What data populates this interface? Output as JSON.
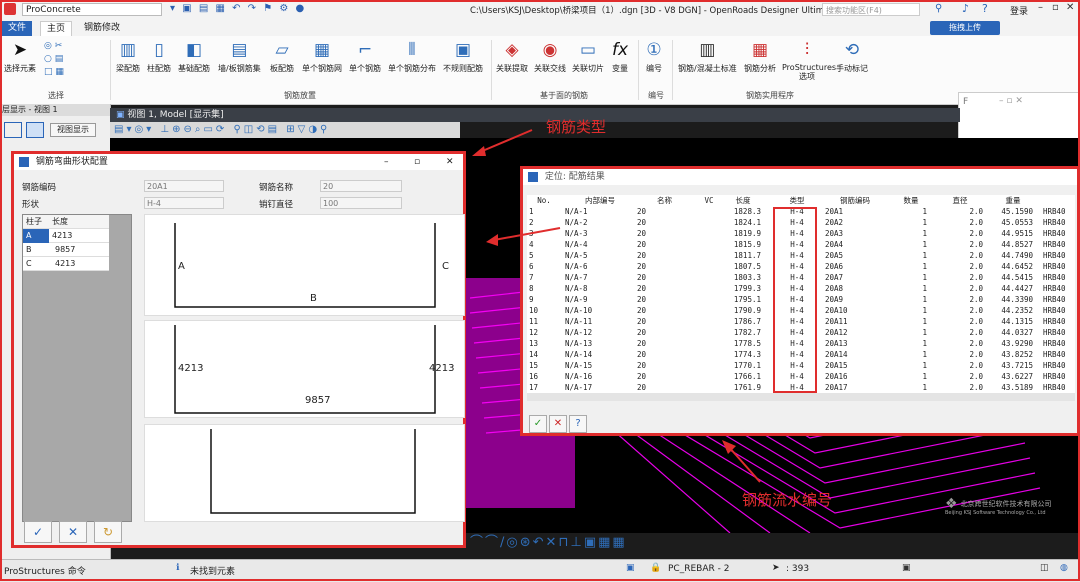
{
  "titlebar": {
    "workflow": "ProConcrete",
    "document": "C:\\Users\\KSJ\\Desktop\\桥梁项目（1）.dgn [3D - V8 DGN] - OpenRoads Designer Ultimate For Ch",
    "search_placeholder": "搜索功能区(F4)",
    "login": "登录",
    "share": "拖拽上传"
  },
  "tabs": [
    {
      "label": "文件"
    },
    {
      "label": "主页"
    },
    {
      "label": "钢筋修改"
    }
  ],
  "ribbon": {
    "select_label": "选择元素",
    "select_group": "选择",
    "buttons": [
      {
        "label": "梁配筋"
      },
      {
        "label": "柱配筋"
      },
      {
        "label": "基础配筋"
      },
      {
        "label": "墙/板钢筋集"
      },
      {
        "label": "板配筋"
      },
      {
        "label": "单个钢筋网"
      },
      {
        "label": "单个钢筋"
      },
      {
        "label": "单个钢筋分布"
      },
      {
        "label": "不规则配筋"
      },
      {
        "label": "关联提取"
      },
      {
        "label": "关联交线"
      },
      {
        "label": "关联切片"
      },
      {
        "label": "变量"
      },
      {
        "label": "编号"
      },
      {
        "label": "钢筋/混凝土标准"
      },
      {
        "label": "钢筋分析"
      },
      {
        "label": "ProStructures 选项"
      },
      {
        "label": "手动标记"
      }
    ],
    "groups": [
      {
        "label": "钢筋放置"
      },
      {
        "label": "基于面的钢筋"
      },
      {
        "label": "编号"
      },
      {
        "label": "钢筋实用程序"
      }
    ]
  },
  "left_panel": {
    "header": "层显示 - 视图 1",
    "display_button": "视图显示"
  },
  "view": {
    "title": "视图 1, Model [显示集]"
  },
  "float_window": {
    "title": "F"
  },
  "shape_dialog": {
    "title": "钢筋弯曲形状配置",
    "code_label": "钢筋编码",
    "code_value": "20A1",
    "name_label": "钢筋名称",
    "name_value": "20",
    "shape_label": "形状",
    "shape_value": "H-4",
    "pin_label": "销钉直径",
    "pin_value": "100",
    "table_headers": [
      "柱子",
      "长度"
    ],
    "table_rows": [
      {
        "col": "A",
        "len": "4213"
      },
      {
        "col": "B",
        "len": "9857"
      },
      {
        "col": "C",
        "len": "4213"
      }
    ],
    "shape1_labels": {
      "a": "A",
      "b": "B",
      "c": "C"
    },
    "shape2_labels": {
      "left": "4213",
      "right": "4213",
      "bottom": "9857"
    }
  },
  "result_dialog": {
    "title": "定位: 配筋结果",
    "headers": [
      "No.",
      "内部编号",
      "名称",
      "VC",
      "长度",
      "类型",
      "钢筋编码",
      "数量",
      "直径",
      "重量",
      ""
    ],
    "rows": [
      [
        "1",
        "N/A-1",
        "20",
        "",
        "1828.3",
        "H-4",
        "20A1",
        "1",
        "2.0",
        "45.1590",
        "HRB40"
      ],
      [
        "2",
        "N/A-2",
        "20",
        "",
        "1824.1",
        "H-4",
        "20A2",
        "1",
        "2.0",
        "45.0553",
        "HRB40"
      ],
      [
        "3",
        "N/A-3",
        "20",
        "",
        "1819.9",
        "H-4",
        "20A3",
        "1",
        "2.0",
        "44.9515",
        "HRB40"
      ],
      [
        "4",
        "N/A-4",
        "20",
        "",
        "1815.9",
        "H-4",
        "20A4",
        "1",
        "2.0",
        "44.8527",
        "HRB40"
      ],
      [
        "5",
        "N/A-5",
        "20",
        "",
        "1811.7",
        "H-4",
        "20A5",
        "1",
        "2.0",
        "44.7490",
        "HRB40"
      ],
      [
        "6",
        "N/A-6",
        "20",
        "",
        "1807.5",
        "H-4",
        "20A6",
        "1",
        "2.0",
        "44.6452",
        "HRB40"
      ],
      [
        "7",
        "N/A-7",
        "20",
        "",
        "1803.3",
        "H-4",
        "20A7",
        "1",
        "2.0",
        "44.5415",
        "HRB40"
      ],
      [
        "8",
        "N/A-8",
        "20",
        "",
        "1799.3",
        "H-4",
        "20A8",
        "1",
        "2.0",
        "44.4427",
        "HRB40"
      ],
      [
        "9",
        "N/A-9",
        "20",
        "",
        "1795.1",
        "H-4",
        "20A9",
        "1",
        "2.0",
        "44.3390",
        "HRB40"
      ],
      [
        "10",
        "N/A-10",
        "20",
        "",
        "1790.9",
        "H-4",
        "20A10",
        "1",
        "2.0",
        "44.2352",
        "HRB40"
      ],
      [
        "11",
        "N/A-11",
        "20",
        "",
        "1786.7",
        "H-4",
        "20A11",
        "1",
        "2.0",
        "44.1315",
        "HRB40"
      ],
      [
        "12",
        "N/A-12",
        "20",
        "",
        "1782.7",
        "H-4",
        "20A12",
        "1",
        "2.0",
        "44.0327",
        "HRB40"
      ],
      [
        "13",
        "N/A-13",
        "20",
        "",
        "1778.5",
        "H-4",
        "20A13",
        "1",
        "2.0",
        "43.9290",
        "HRB40"
      ],
      [
        "14",
        "N/A-14",
        "20",
        "",
        "1774.3",
        "H-4",
        "20A14",
        "1",
        "2.0",
        "43.8252",
        "HRB40"
      ],
      [
        "15",
        "N/A-15",
        "20",
        "",
        "1770.1",
        "H-4",
        "20A15",
        "1",
        "2.0",
        "43.7215",
        "HRB40"
      ],
      [
        "16",
        "N/A-16",
        "20",
        "",
        "1766.1",
        "H-4",
        "20A16",
        "1",
        "2.0",
        "43.6227",
        "HRB40"
      ],
      [
        "17",
        "N/A-17",
        "20",
        "",
        "1761.9",
        "H-4",
        "20A17",
        "1",
        "2.0",
        "43.5189",
        "HRB40"
      ]
    ]
  },
  "annotations": {
    "rebar_type": "钢筋类型",
    "rebar_serial": "钢筋流水编号"
  },
  "watermark": {
    "company": "北京跨世纪软件技术有限公司",
    "company_en": "Beijing KSJ Software Technology Co., Ltd"
  },
  "statusbar": {
    "command": "ProStructures 命令",
    "message": "未找到元素",
    "level": "PC_REBAR - 2",
    "count": ": 393"
  },
  "colors": {
    "accent": "#2a65b8",
    "annotation": "#e02d2d",
    "rebar": "#ff00ff"
  }
}
